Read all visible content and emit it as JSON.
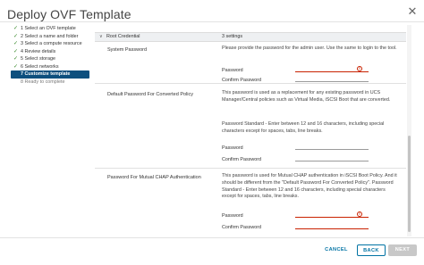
{
  "dialog": {
    "title": "Deploy OVF Template"
  },
  "steps": [
    {
      "label": "1 Select an OVF template",
      "state": "done"
    },
    {
      "label": "2 Select a name and folder",
      "state": "done"
    },
    {
      "label": "3 Select a compute resource",
      "state": "done"
    },
    {
      "label": "4 Review details",
      "state": "done"
    },
    {
      "label": "5 Select storage",
      "state": "done"
    },
    {
      "label": "6 Select networks",
      "state": "done"
    },
    {
      "label": "7 Customize template",
      "state": "active"
    },
    {
      "label": "8 Ready to complete",
      "state": "disabled"
    }
  ],
  "section": {
    "name": "Root Credential",
    "count": "3 settings"
  },
  "properties": {
    "system_password": {
      "label": "System Password",
      "desc": "Please provide the password for the admin user. Use the same to login to the tool.",
      "password_label": "Password",
      "confirm_label": "Confirm Password",
      "password_value": "",
      "confirm_value": ""
    },
    "converted_password": {
      "label": "Default Password For Converted Policy",
      "desc1": "This password is used as a replacement for any existing password in UCS Manager/Central policies such as Virtual Media, iSCSI Boot that are converted.",
      "desc2": "Password Standard - Enter between 12 and 16 characters, including special characters except for spaces, tabs, line breaks.",
      "password_label": "Password",
      "confirm_label": "Confirm Password",
      "password_value": "",
      "confirm_value": ""
    },
    "chap_password": {
      "label": "Password For Mutual CHAP Authentication",
      "desc": "This password is used for Mutual CHAP authentication in iSCSI Boot Policy. And it should be different from the \"Default Password For Converted Policy\". Password Standard - Enter between 12 and 16 characters, including special characters except for spaces, tabs, line breaks.",
      "password_label": "Password",
      "confirm_label": "Confirm Password",
      "password_value": "",
      "confirm_value": ""
    }
  },
  "footer": {
    "cancel": "CANCEL",
    "back": "BACK",
    "next": "NEXT"
  },
  "colors": {
    "accent": "#0072a3",
    "active_step": "#0d4f7e",
    "error": "#c92100",
    "check": "#3a8a2b"
  },
  "icons": {
    "done": "check-icon",
    "close": "close-icon",
    "error": "error-icon",
    "collapse": "chevron-down-icon"
  }
}
